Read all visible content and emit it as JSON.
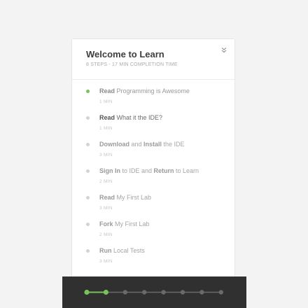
{
  "card": {
    "title": "Welcome to Learn",
    "subtitle": "8 STEPS - 17 MIN COMPLETION TIME",
    "collapse_icon": "double-chevron-down-icon"
  },
  "steps": [
    {
      "verb": "Read",
      "rest": " Programming is Awesome",
      "parts": null,
      "time": "1 MIN",
      "state": "done"
    },
    {
      "verb": "Read",
      "rest": " What it the IDE?",
      "parts": null,
      "time": "1 MIN",
      "state": "active"
    },
    {
      "verb": "Download",
      "rest": "",
      "parts": [
        [
          "Download",
          true
        ],
        [
          " and ",
          false
        ],
        [
          "Install",
          true
        ],
        [
          " the IDE",
          false
        ]
      ],
      "time": "3 MIN",
      "state": "todo"
    },
    {
      "verb": "Sign In",
      "rest": "",
      "parts": [
        [
          "Sign In",
          true
        ],
        [
          " to IDE and ",
          false
        ],
        [
          "Return",
          true
        ],
        [
          " to Learn",
          false
        ]
      ],
      "time": "2 MIN",
      "state": "todo"
    },
    {
      "verb": "Read",
      "rest": " My First Lab",
      "parts": null,
      "time": "3 MIN",
      "state": "todo"
    },
    {
      "verb": "Fork",
      "rest": " My First Lab",
      "parts": null,
      "time": "2 MIN",
      "state": "todo"
    },
    {
      "verb": "Run",
      "rest": " Local Tests",
      "parts": null,
      "time": "3 MIN",
      "state": "todo"
    }
  ],
  "progress": {
    "total_steps": 8,
    "completed_steps": 2,
    "colors": {
      "complete": "#77c35a",
      "incomplete": "#6a6a6a",
      "background": "#303030"
    }
  }
}
